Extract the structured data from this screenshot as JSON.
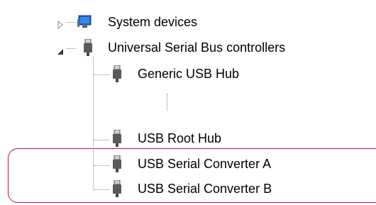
{
  "tree": {
    "system_devices": {
      "label": "System devices",
      "expander": "collapsed",
      "icon": "system-devices-icon"
    },
    "usb_controllers": {
      "label": "Universal Serial Bus controllers",
      "expander": "expanded",
      "icon": "usb-plug-icon",
      "children": [
        {
          "label": "Generic USB Hub",
          "icon": "usb-plug-icon"
        },
        {
          "label": "USB Root Hub",
          "icon": "usb-plug-icon"
        },
        {
          "label": "USB Serial Converter A",
          "icon": "usb-plug-icon"
        },
        {
          "label": "USB Serial Converter B",
          "icon": "usb-plug-icon"
        }
      ]
    }
  },
  "colors": {
    "highlight": "#b01c2e",
    "tree_lines": "#8a8a8a"
  }
}
